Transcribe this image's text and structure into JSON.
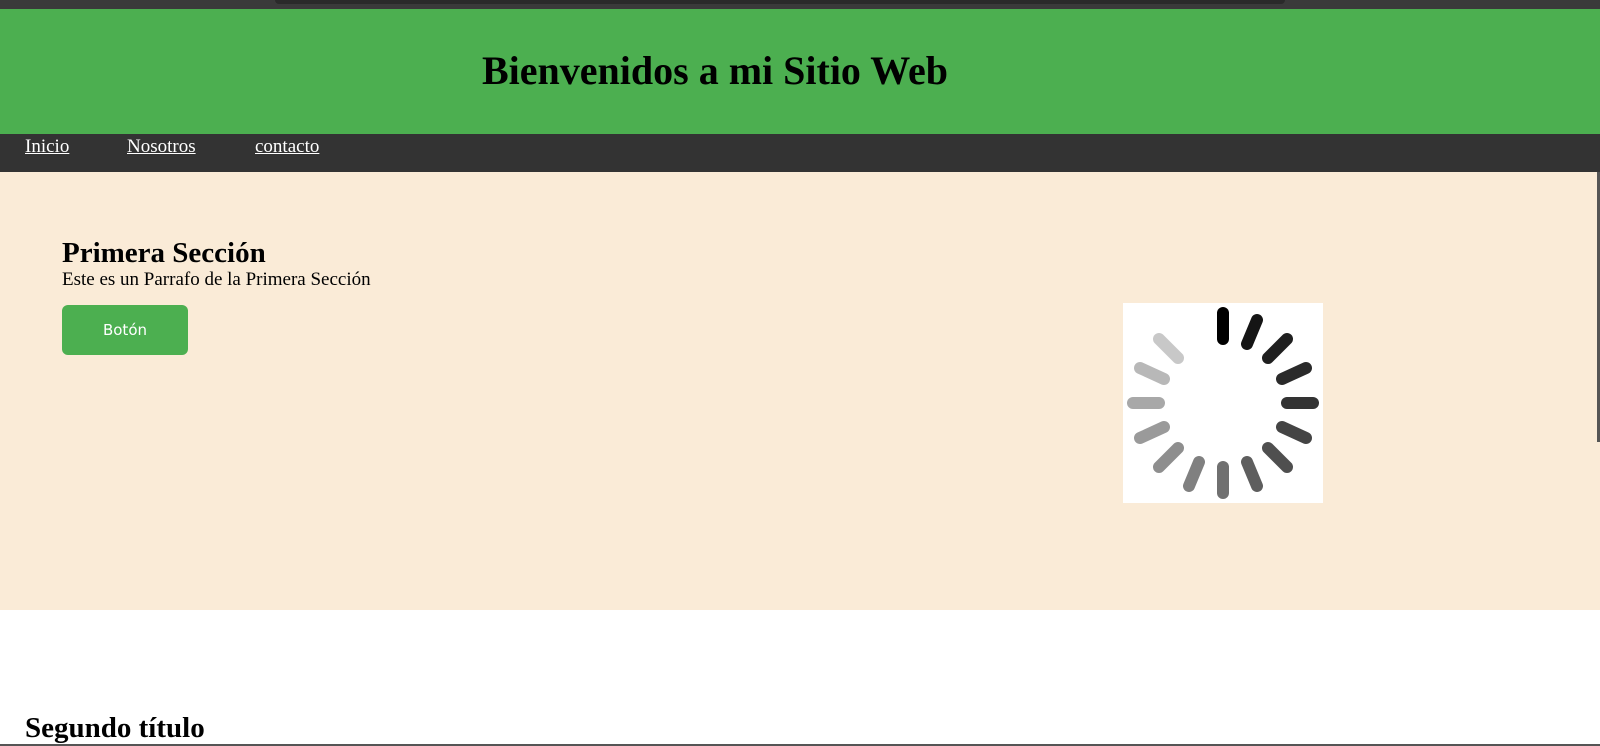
{
  "header": {
    "title": "Bienvenidos a mi Sitio Web",
    "color": "#4caf50"
  },
  "nav": {
    "items": [
      {
        "label": "Inicio"
      },
      {
        "label": "Nosotros"
      },
      {
        "label": "contacto"
      }
    ],
    "color": "#333333"
  },
  "primera": {
    "heading": "Primera Sección",
    "paragraph": "Este es un Parrafo de la Primera Sección",
    "button_label": "Botón",
    "background": "#faebd7",
    "spinner_icon": "loading-spinner-icon"
  },
  "segundo": {
    "heading": "Segundo título"
  }
}
